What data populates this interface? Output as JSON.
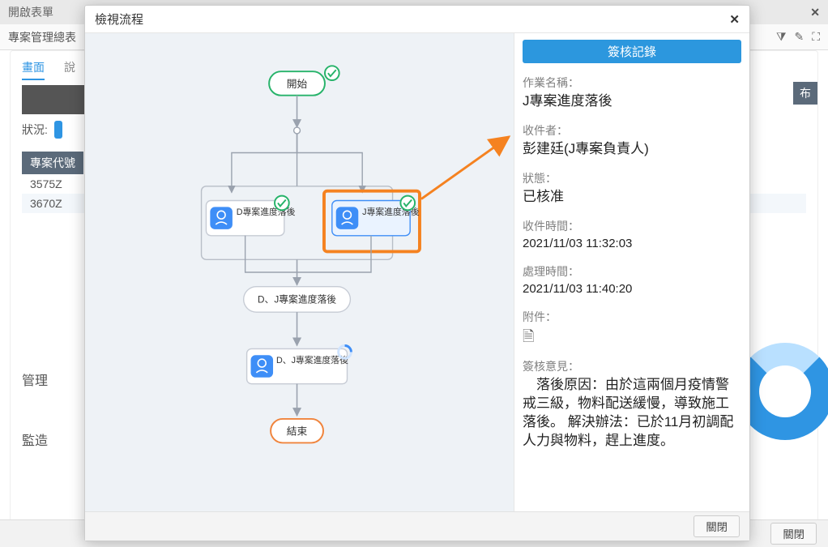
{
  "backdrop": {
    "top_bar_title": "開啟表單",
    "sub_bar_title": "專案管理總表",
    "tabs": {
      "active": "畫面",
      "other": "說"
    },
    "status_label": "狀況:",
    "publish_text": "布",
    "table_header": "專案代號",
    "rows": [
      "3575Z",
      "3670Z"
    ],
    "left_words": {
      "manage": "管理",
      "build": "監造"
    },
    "close_button_label": "關閉"
  },
  "modal": {
    "title": "檢視流程",
    "close_button_label": "關閉",
    "info_header": "簽核記錄",
    "fields": {
      "task_name_label": "作業名稱：",
      "task_name_value": "J專案進度落後",
      "recipient_label": "收件者：",
      "recipient_value": "彭建廷(J專案負責人)",
      "state_label": "狀態：",
      "state_value": "已核准",
      "recv_time_label": "收件時間：",
      "recv_time_value": "2021/11/03 11:32:03",
      "proc_time_label": "處理時間：",
      "proc_time_value": "2021/11/03 11:40:20",
      "attachment_label": "附件：",
      "comment_label": "簽核意見：",
      "comment_value": "落後原因：由於這兩個月疫情警戒三級，物料配送緩慢，導致施工落後。 解決辦法：已於11月初調配人力與物料，趕上進度。"
    },
    "flow": {
      "start_label": "開始",
      "node_d_label": "D專案進度落後",
      "node_j_label": "J專案進度落後",
      "merge_label": "D、J專案進度落後",
      "merge2_label": "D、J專案進度落後",
      "end_label": "結束"
    }
  }
}
